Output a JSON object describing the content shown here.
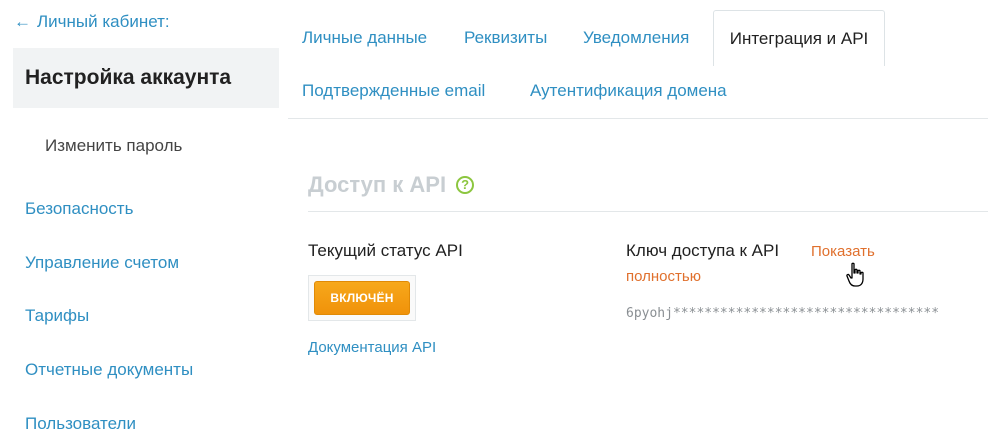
{
  "sidebar": {
    "back_label": "Личный кабинет:",
    "active_title": "Настройка аккаунта",
    "sub_item": "Изменить пароль",
    "items": [
      {
        "label": "Безопасность"
      },
      {
        "label": "Управление счетом"
      },
      {
        "label": "Тарифы"
      },
      {
        "label": "Отчетные документы"
      },
      {
        "label": "Пользователи"
      }
    ]
  },
  "tabs": {
    "row1": [
      {
        "label": "Личные данные"
      },
      {
        "label": "Реквизиты"
      },
      {
        "label": "Уведомления"
      },
      {
        "label": "Интеграция и API",
        "active": true
      }
    ],
    "row2": [
      {
        "label": "Подтвержденные email"
      },
      {
        "label": "Аутентификация домена"
      }
    ]
  },
  "content": {
    "section_title": "Доступ к API",
    "help_icon": "question-circle-icon",
    "status_label": "Текущий статус API",
    "status_button": "ВКЛЮЧЁН",
    "docs_link": "Документация API",
    "key_label": "Ключ доступа к API",
    "show_full_part1": "Показать",
    "show_full_part2": "полностью",
    "api_key_masked": "6pyohj**********************************"
  },
  "colors": {
    "link": "#2f8fc2",
    "accent_orange": "#f39c12",
    "show_link": "#e0702d",
    "help_green": "#8cc63f"
  }
}
